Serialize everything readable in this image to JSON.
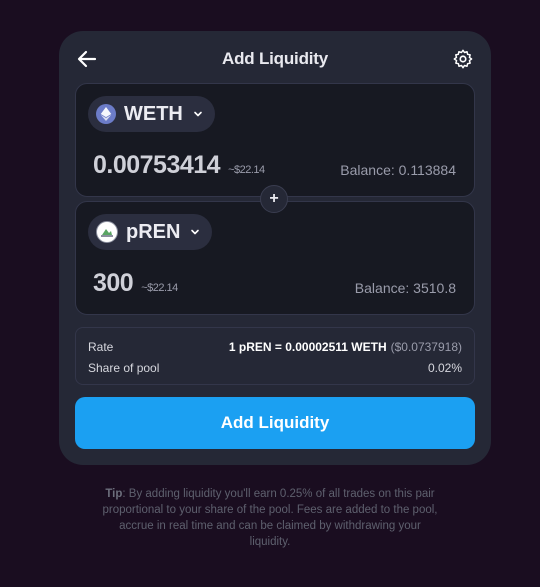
{
  "header": {
    "title": "Add Liquidity"
  },
  "input_a": {
    "token": "WETH",
    "amount": "0.00753414",
    "usd_value": "~$22.14",
    "balance": "Balance: 0.113884"
  },
  "input_b": {
    "token": "pREN",
    "amount": "300",
    "usd_value": "~$22.14",
    "balance": "Balance: 3510.8"
  },
  "plus_symbol": "+",
  "info": {
    "rate_label": "Rate",
    "rate_value": "1 pREN = 0.00002511 WETH",
    "rate_usd": "($0.0737918)",
    "share_label": "Share of pool",
    "share_value": "0.02%"
  },
  "submit_label": "Add Liquidity",
  "tip": {
    "prefix": "Tip",
    "text": ": By adding liquidity you'll earn 0.25% of all trades on this pair proportional to your share of the pool. Fees are added to the pool, accrue in real time and can be claimed by withdrawing your liquidity."
  },
  "icons": {
    "back": "arrow-left-icon",
    "settings": "gear-icon",
    "weth": "ethereum-icon",
    "pren": "pren-token-icon",
    "dropdown": "chevron-down-icon"
  },
  "colors": {
    "background": "#1a0d20",
    "card": "#252836",
    "accent": "#1ba0f2"
  }
}
